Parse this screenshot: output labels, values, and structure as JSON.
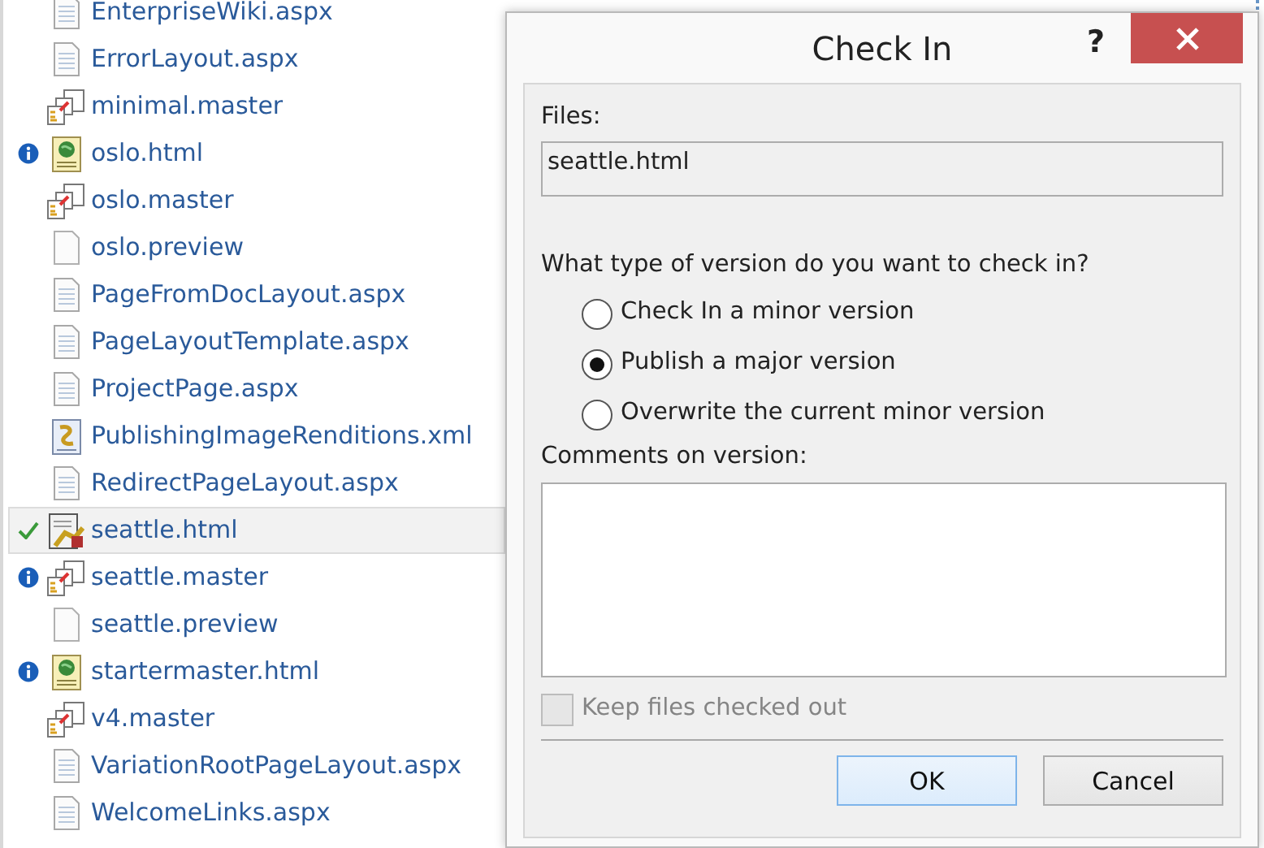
{
  "files": [
    {
      "name": "EnterpriseWiki.aspx",
      "kind": "page",
      "info": false,
      "checked": false,
      "selected": false
    },
    {
      "name": "ErrorLayout.aspx",
      "kind": "page",
      "info": false,
      "checked": false,
      "selected": false
    },
    {
      "name": "minimal.master",
      "kind": "master",
      "info": false,
      "checked": false,
      "selected": false
    },
    {
      "name": "oslo.html",
      "kind": "html",
      "info": true,
      "checked": false,
      "selected": false
    },
    {
      "name": "oslo.master",
      "kind": "master",
      "info": false,
      "checked": false,
      "selected": false
    },
    {
      "name": "oslo.preview",
      "kind": "blank",
      "info": false,
      "checked": false,
      "selected": false
    },
    {
      "name": "PageFromDocLayout.aspx",
      "kind": "page",
      "info": false,
      "checked": false,
      "selected": false
    },
    {
      "name": "PageLayoutTemplate.aspx",
      "kind": "page",
      "info": false,
      "checked": false,
      "selected": false
    },
    {
      "name": "ProjectPage.aspx",
      "kind": "page",
      "info": false,
      "checked": false,
      "selected": false
    },
    {
      "name": "PublishingImageRenditions.xml",
      "kind": "xml",
      "info": false,
      "checked": false,
      "selected": false
    },
    {
      "name": "RedirectPageLayout.aspx",
      "kind": "page",
      "info": false,
      "checked": false,
      "selected": false
    },
    {
      "name": "seattle.html",
      "kind": "edited",
      "info": false,
      "checked": true,
      "selected": true
    },
    {
      "name": "seattle.master",
      "kind": "master",
      "info": true,
      "checked": false,
      "selected": false
    },
    {
      "name": "seattle.preview",
      "kind": "blank",
      "info": false,
      "checked": false,
      "selected": false
    },
    {
      "name": "startermaster.html",
      "kind": "html",
      "info": true,
      "checked": false,
      "selected": false
    },
    {
      "name": "v4.master",
      "kind": "master",
      "info": false,
      "checked": false,
      "selected": false
    },
    {
      "name": "VariationRootPageLayout.aspx",
      "kind": "page",
      "info": false,
      "checked": false,
      "selected": false
    },
    {
      "name": "WelcomeLinks.aspx",
      "kind": "page",
      "info": false,
      "checked": false,
      "selected": false
    }
  ],
  "dialog": {
    "title": "Check In",
    "help": "?",
    "files_label": "Files:",
    "files_value": "seattle.html",
    "version_question": "What type of version do you want to check in?",
    "options": [
      {
        "label": "Check In a minor version",
        "selected": false
      },
      {
        "label": "Publish a major version",
        "selected": true
      },
      {
        "label": "Overwrite the current minor version",
        "selected": false
      }
    ],
    "comments_label": "Comments on version:",
    "keep_checked_out": {
      "label": "Keep files checked out",
      "checked": false,
      "disabled": true
    },
    "buttons": [
      {
        "label": "OK",
        "selected": true
      },
      {
        "label": "Cancel",
        "selected": false
      }
    ]
  }
}
